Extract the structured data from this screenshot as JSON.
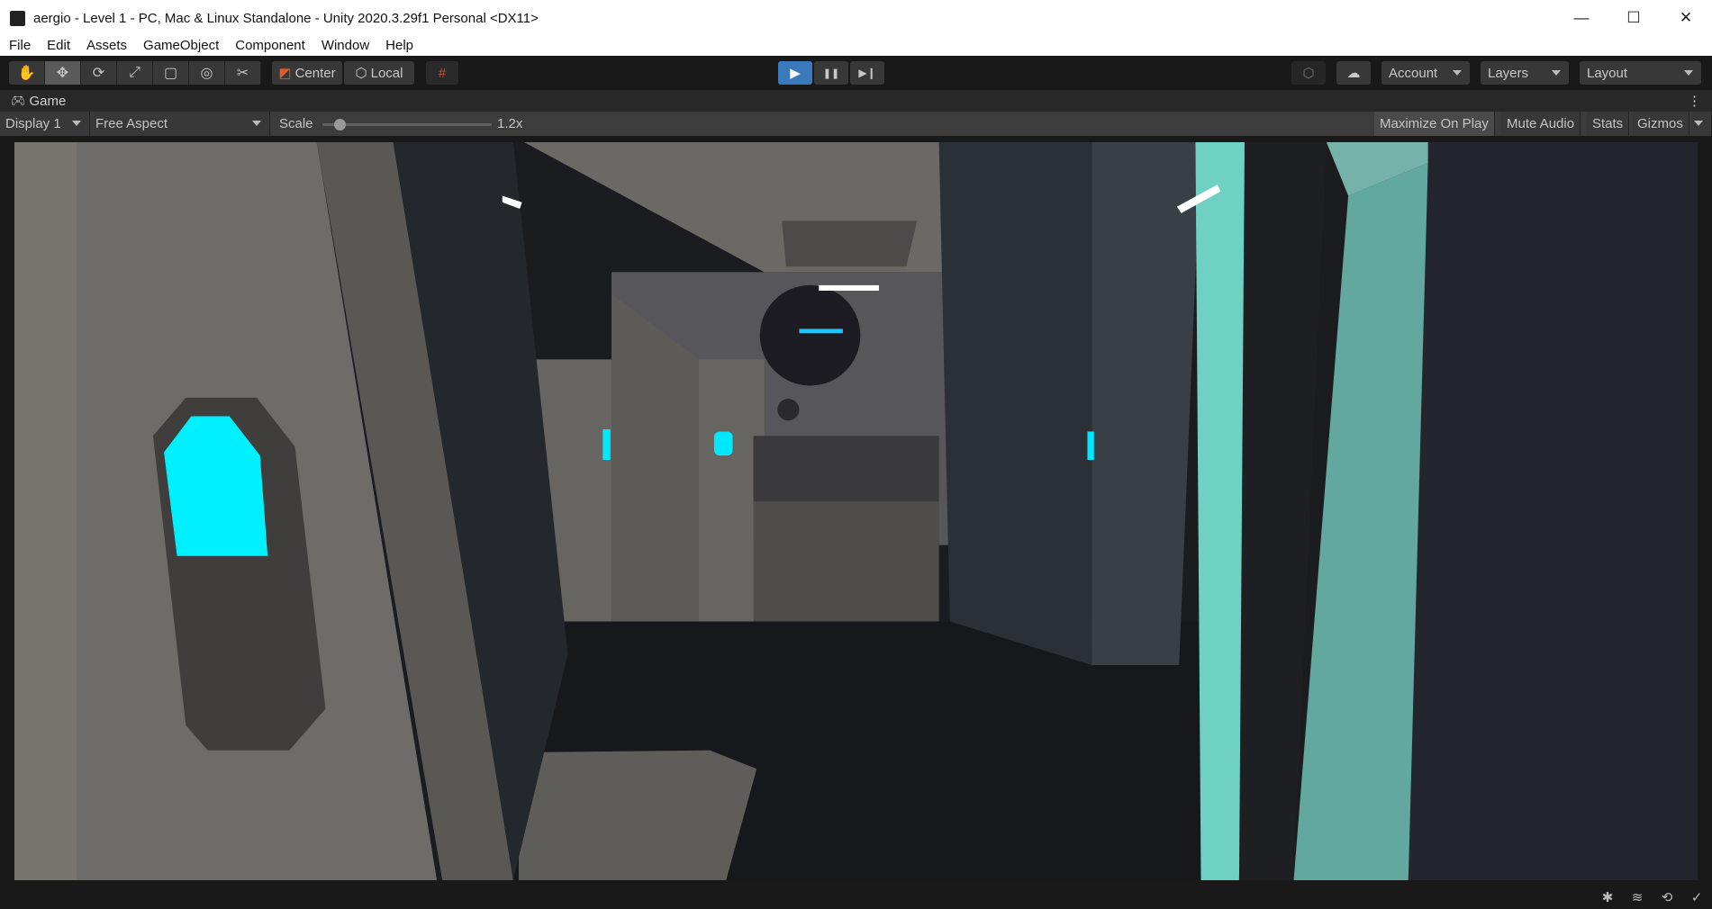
{
  "window": {
    "title": "aergio - Level 1 - PC, Mac & Linux Standalone - Unity 2020.3.29f1 Personal <DX11>",
    "minimize": "—",
    "maximize": "☐",
    "close": "✕"
  },
  "menu": [
    "File",
    "Edit",
    "Assets",
    "GameObject",
    "Component",
    "Window",
    "Help"
  ],
  "toolbar": {
    "tools": [
      {
        "name": "hand",
        "glyph": "✋"
      },
      {
        "name": "move",
        "glyph": "✥"
      },
      {
        "name": "rotate",
        "glyph": "⟳"
      },
      {
        "name": "scale",
        "glyph": "⤢"
      },
      {
        "name": "rect",
        "glyph": "▢"
      },
      {
        "name": "transform",
        "glyph": "◎"
      },
      {
        "name": "custom",
        "glyph": "✂"
      }
    ],
    "pivot": "Center",
    "space": "Local",
    "snap": "#",
    "account": "Account",
    "layers": "Layers",
    "layout": "Layout",
    "play": "▶",
    "pause": "❚❚",
    "step": "▶❙"
  },
  "game_tab": {
    "label": "Game",
    "menu": "⋮"
  },
  "game_toolbar": {
    "display": "Display 1",
    "aspect": "Free Aspect",
    "scale_label": "Scale",
    "scale_value": "1.2x",
    "scale_fraction": 0.07,
    "maximize": "Maximize On Play",
    "mute": "Mute Audio",
    "stats": "Stats",
    "gizmos": "Gizmos"
  },
  "colors": {
    "accent": "#3a79bb",
    "cyan": "#00f0ff",
    "teal": "#6fd0c4"
  }
}
